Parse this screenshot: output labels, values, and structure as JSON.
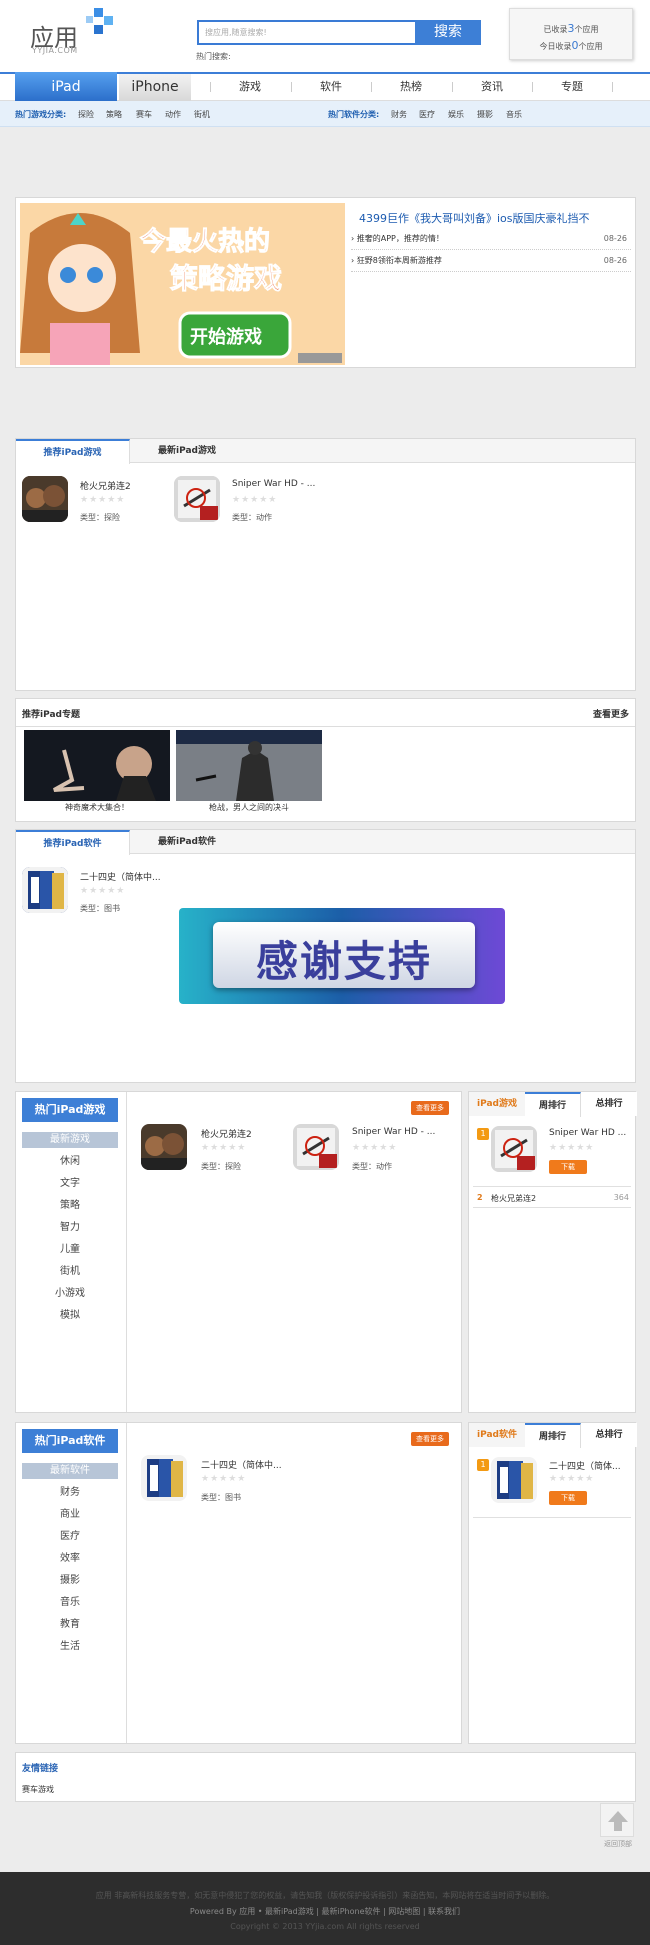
{
  "header": {
    "logo_text": "应用",
    "logo_sub": "YYJIA.COM",
    "search_placeholder": "搜应用,随意搜索!",
    "search_button": "搜索",
    "hot_search": "热门搜索:",
    "stats": {
      "line1_prefix": "已收录",
      "line1_count": "3",
      "line1_suffix": "个应用",
      "line2_prefix": "今日收录",
      "line2_count": "0",
      "line2_suffix": "个应用"
    }
  },
  "nav": {
    "tab_ipad": "iPad",
    "tab_iphone": "iPhone",
    "items": [
      "游戏",
      "软件",
      "热榜",
      "资讯",
      "专题"
    ]
  },
  "subnav": {
    "games_label": "热门游戏分类:",
    "games": [
      "探险",
      "策略",
      "赛车",
      "动作",
      "街机"
    ],
    "software_label": "热门软件分类:",
    "software": [
      "财务",
      "医疗",
      "娱乐",
      "摄影",
      "音乐"
    ]
  },
  "banner": {
    "image_text_line1": "今最火热的",
    "image_text_line2": "策略游戏",
    "image_button": "开始游戏",
    "headline": "4399巨作《我大哥叫刘备》ios版国庆豪礼挡不",
    "news": [
      {
        "title": "推奢的APP，推荐的情！",
        "date": "08-26"
      },
      {
        "title": "狂野8领衔本周新游推荐",
        "date": "08-26"
      }
    ]
  },
  "games_panel": {
    "tab_recommended": "推荐iPad游戏",
    "tab_latest": "最新iPad游戏",
    "apps": [
      {
        "name": "枪火兄弟连2",
        "type_label": "类型：",
        "type": "探险",
        "stars": "★★★★★"
      },
      {
        "name": "Sniper War HD - ...",
        "type_label": "类型：",
        "type": "动作",
        "stars": "★★★★★"
      }
    ]
  },
  "topics_panel": {
    "title": "推荐iPad专题",
    "more": "查看更多",
    "topics": [
      {
        "caption": "神奇魔术大集合！"
      },
      {
        "caption": "枪战，男人之间的决斗"
      }
    ]
  },
  "software_panel": {
    "tab_recommended": "推荐iPad软件",
    "tab_latest": "最新iPad软件",
    "apps": [
      {
        "name": "二十四史（简体中...",
        "type_label": "类型：",
        "type": "图书",
        "stars": "★★★★★"
      }
    ],
    "thanks_text": "感谢支持"
  },
  "hot_games": {
    "side_title": "热门iPad游戏",
    "menu": [
      "最新游戏",
      "休闲",
      "文字",
      "策略",
      "智力",
      "儿童",
      "街机",
      "小游戏",
      "模拟"
    ],
    "more": "查看更多",
    "apps": [
      {
        "name": "枪火兄弟连2",
        "type_label": "类型：",
        "type": "探险",
        "stars": "★★★★★"
      },
      {
        "name": "Sniper War HD - ...",
        "type_label": "类型：",
        "type": "动作",
        "stars": "★★★★★"
      }
    ],
    "rank_tabs": [
      "iPad游戏",
      "周排行",
      "总排行"
    ],
    "rank_top": {
      "num": "1",
      "name": "Sniper War HD ...",
      "stars": "★★★★★",
      "download": "下载"
    },
    "rank_rows": [
      {
        "num": "2",
        "name": "枪火兄弟连2",
        "count": "364"
      }
    ]
  },
  "hot_software": {
    "side_title": "热门iPad软件",
    "menu": [
      "最新软件",
      "财务",
      "商业",
      "医疗",
      "效率",
      "摄影",
      "音乐",
      "教育",
      "生活"
    ],
    "more": "查看更多",
    "apps": [
      {
        "name": "二十四史（简体中...",
        "type_label": "类型：",
        "type": "图书",
        "stars": "★★★★★"
      }
    ],
    "rank_tabs": [
      "iPad软件",
      "周排行",
      "总排行"
    ],
    "rank_top": {
      "num": "1",
      "name": "二十四史（简体...",
      "stars": "★★★★★",
      "download": "下载"
    }
  },
  "friend_links": {
    "title": "友情链接",
    "links": [
      "赛车游戏"
    ]
  },
  "back_top": "返回顶部",
  "footer": {
    "line1": "应用 非高新科技服务专营，如无意中侵犯了您的权益，请告知我（版权保护投诉指引）来函告知，本网站将在适当时间予以删除。",
    "line2": "Powered By 应用 • 最新iPad游戏 | 最新iPhone软件 | 网站地图 | 联系我们",
    "line3": "Copyright © 2013 YYjia.com All rights reserved"
  },
  "colors": {
    "accent": "#3d7fd6",
    "orange": "#e86a1c",
    "footer_bg": "#2d2d2d"
  }
}
